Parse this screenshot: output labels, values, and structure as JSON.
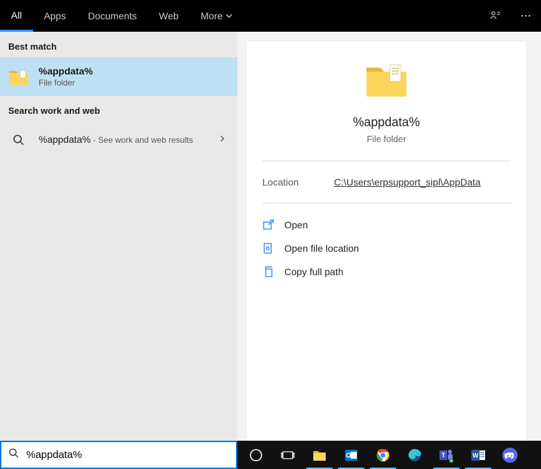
{
  "tabs": {
    "all": "All",
    "apps": "Apps",
    "documents": "Documents",
    "web": "Web",
    "more": "More"
  },
  "left": {
    "best_match_head": "Best match",
    "best_match": {
      "title": "%appdata%",
      "subtitle": "File folder"
    },
    "work_web_head": "Search work and web",
    "work_web": {
      "title": "%appdata%",
      "suffix": " - See work and web results"
    }
  },
  "detail": {
    "title": "%appdata%",
    "subtitle": "File folder",
    "location_label": "Location",
    "location_value": "C:\\Users\\erpsupport_sipl\\AppData",
    "actions": {
      "open": "Open",
      "open_file_location": "Open file location",
      "copy_full_path": "Copy full path"
    }
  },
  "search": {
    "value": "%appdata%"
  },
  "taskbar": {
    "cortana": "cortana",
    "task_view": "task-view",
    "file_explorer": "file-explorer",
    "outlook": "outlook",
    "chrome": "chrome",
    "edge": "edge",
    "teams": "teams",
    "word": "word",
    "discord": "discord"
  }
}
